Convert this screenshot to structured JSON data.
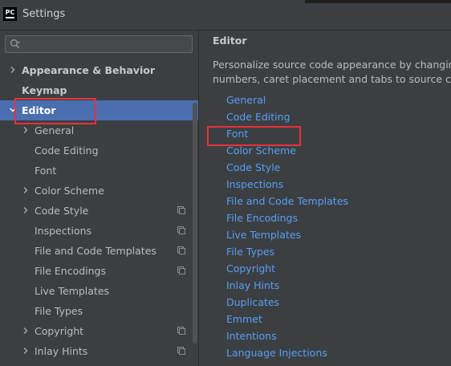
{
  "window": {
    "title": "Settings",
    "app_icon_text": "PC"
  },
  "search": {
    "placeholder": "",
    "value": ""
  },
  "sidebar": {
    "items": [
      {
        "label": "Appearance & Behavior",
        "level": 0,
        "chevron": "right",
        "bold": true,
        "selected": false
      },
      {
        "label": "Keymap",
        "level": 0,
        "chevron": "none",
        "bold": true,
        "selected": false
      },
      {
        "label": "Editor",
        "level": 0,
        "chevron": "down",
        "bold": true,
        "selected": true
      },
      {
        "label": "General",
        "level": 1,
        "chevron": "right",
        "bold": false,
        "selected": false
      },
      {
        "label": "Code Editing",
        "level": 1,
        "chevron": "none",
        "bold": false,
        "selected": false
      },
      {
        "label": "Font",
        "level": 1,
        "chevron": "none",
        "bold": false,
        "selected": false
      },
      {
        "label": "Color Scheme",
        "level": 1,
        "chevron": "right",
        "bold": false,
        "selected": false
      },
      {
        "label": "Code Style",
        "level": 1,
        "chevron": "right",
        "bold": false,
        "selected": false,
        "project_icon": true
      },
      {
        "label": "Inspections",
        "level": 1,
        "chevron": "none",
        "bold": false,
        "selected": false,
        "project_icon": true
      },
      {
        "label": "File and Code Templates",
        "level": 1,
        "chevron": "none",
        "bold": false,
        "selected": false,
        "project_icon": true
      },
      {
        "label": "File Encodings",
        "level": 1,
        "chevron": "none",
        "bold": false,
        "selected": false,
        "project_icon": true
      },
      {
        "label": "Live Templates",
        "level": 1,
        "chevron": "none",
        "bold": false,
        "selected": false
      },
      {
        "label": "File Types",
        "level": 1,
        "chevron": "none",
        "bold": false,
        "selected": false
      },
      {
        "label": "Copyright",
        "level": 1,
        "chevron": "right",
        "bold": false,
        "selected": false,
        "project_icon": true
      },
      {
        "label": "Inlay Hints",
        "level": 1,
        "chevron": "right",
        "bold": false,
        "selected": false,
        "project_icon": true
      }
    ]
  },
  "main": {
    "title": "Editor",
    "description_line1": "Personalize source code appearance by changing f",
    "description_line2": "numbers, caret placement and tabs to source code",
    "links": [
      "General",
      "Code Editing",
      "Font",
      "Color Scheme",
      "Code Style",
      "Inspections",
      "File and Code Templates",
      "File Encodings",
      "Live Templates",
      "File Types",
      "Copyright",
      "Inlay Hints",
      "Duplicates",
      "Emmet",
      "Intentions",
      "Language Injections"
    ]
  },
  "icons": {
    "search": "search-icon",
    "chevron_right": "chevron-right-icon",
    "chevron_down": "chevron-down-icon",
    "project_scope": "project-scope-icon"
  },
  "colors": {
    "background": "#3c3f41",
    "selection": "#4b6eaf",
    "link": "#589df6",
    "highlight_box": "#e8313b"
  }
}
